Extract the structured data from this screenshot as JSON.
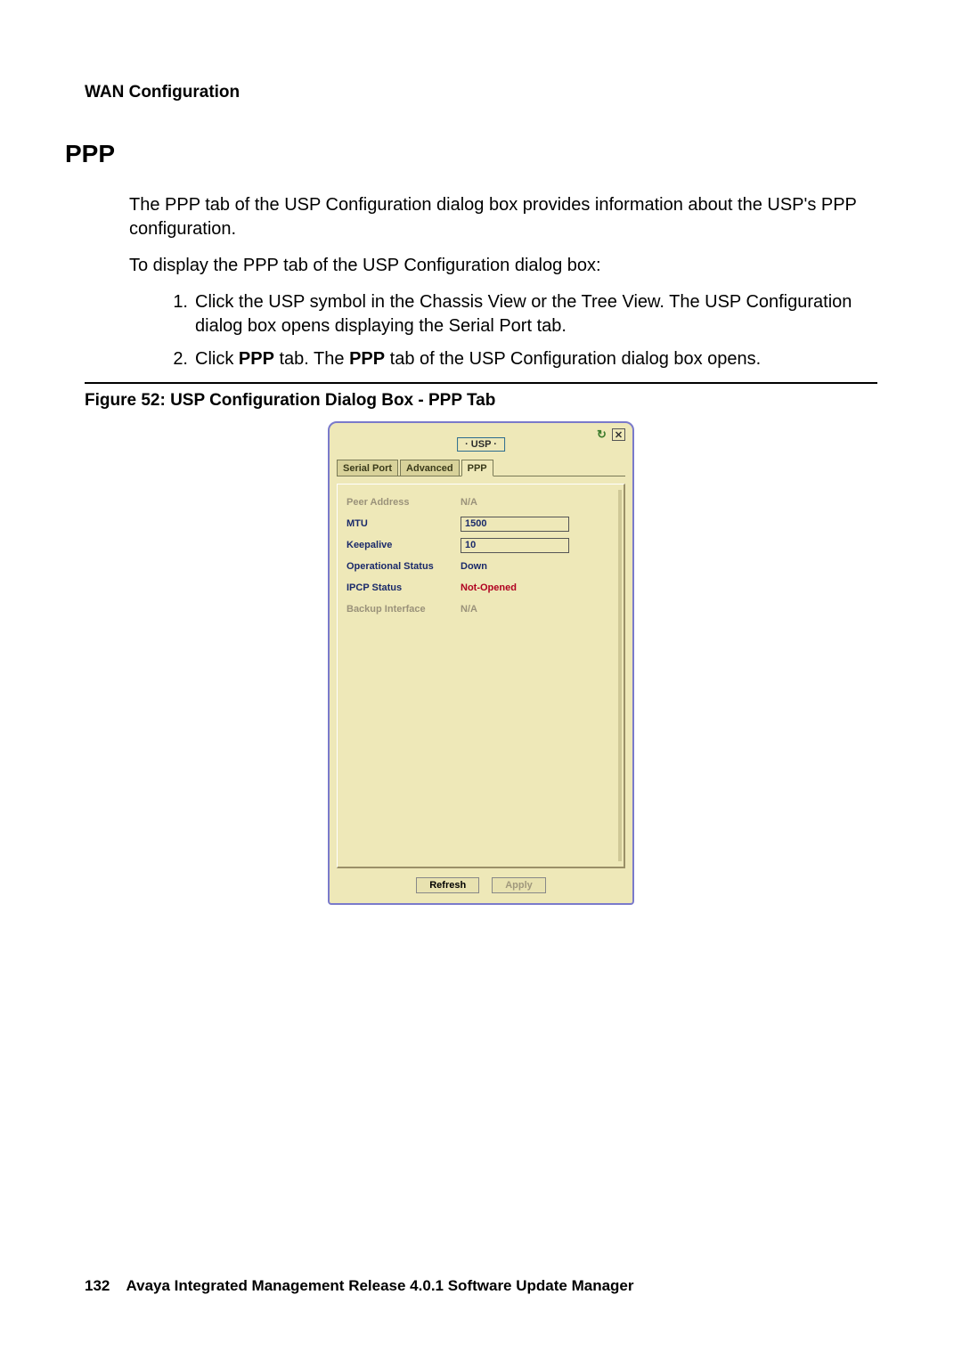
{
  "header": {
    "section": "WAN Configuration"
  },
  "section": {
    "title": "PPP"
  },
  "intro": {
    "p1": "The PPP tab of the USP Configuration dialog box provides information about the USP's PPP configuration.",
    "p2": "To display the PPP tab of the USP Configuration dialog box:"
  },
  "steps": {
    "s1_num": "1.",
    "s1_text_a": "Click the USP symbol in the Chassis View or the Tree View. The USP Configuration dialog box opens displaying the Serial Port tab.",
    "s2_num": "2.",
    "s2_text_a": "Click ",
    "s2_bold1": "PPP",
    "s2_text_b": " tab. The ",
    "s2_bold2": "PPP",
    "s2_text_c": " tab of the USP Configuration dialog box opens."
  },
  "figure": {
    "caption": "Figure 52: USP Configuration Dialog Box - PPP Tab"
  },
  "dialog": {
    "title": "· USP ·",
    "tabs": {
      "serial": "Serial Port",
      "advanced": "Advanced",
      "ppp": "PPP"
    },
    "fields": {
      "peer_address": {
        "label": "Peer Address",
        "value": "N/A"
      },
      "mtu": {
        "label": "MTU",
        "value": "1500"
      },
      "keepalive": {
        "label": "Keepalive",
        "value": "10"
      },
      "op_status": {
        "label": "Operational Status",
        "value": "Down"
      },
      "ipcp_status": {
        "label": "IPCP Status",
        "value": "Not-Opened"
      },
      "backup": {
        "label": "Backup Interface",
        "value": "N/A"
      }
    },
    "buttons": {
      "refresh": "Refresh",
      "apply": "Apply"
    },
    "close_glyph": "✕",
    "refresh_glyph": "↻"
  },
  "footer": {
    "page": "132",
    "title": "Avaya Integrated Management Release 4.0.1 Software Update Manager"
  }
}
